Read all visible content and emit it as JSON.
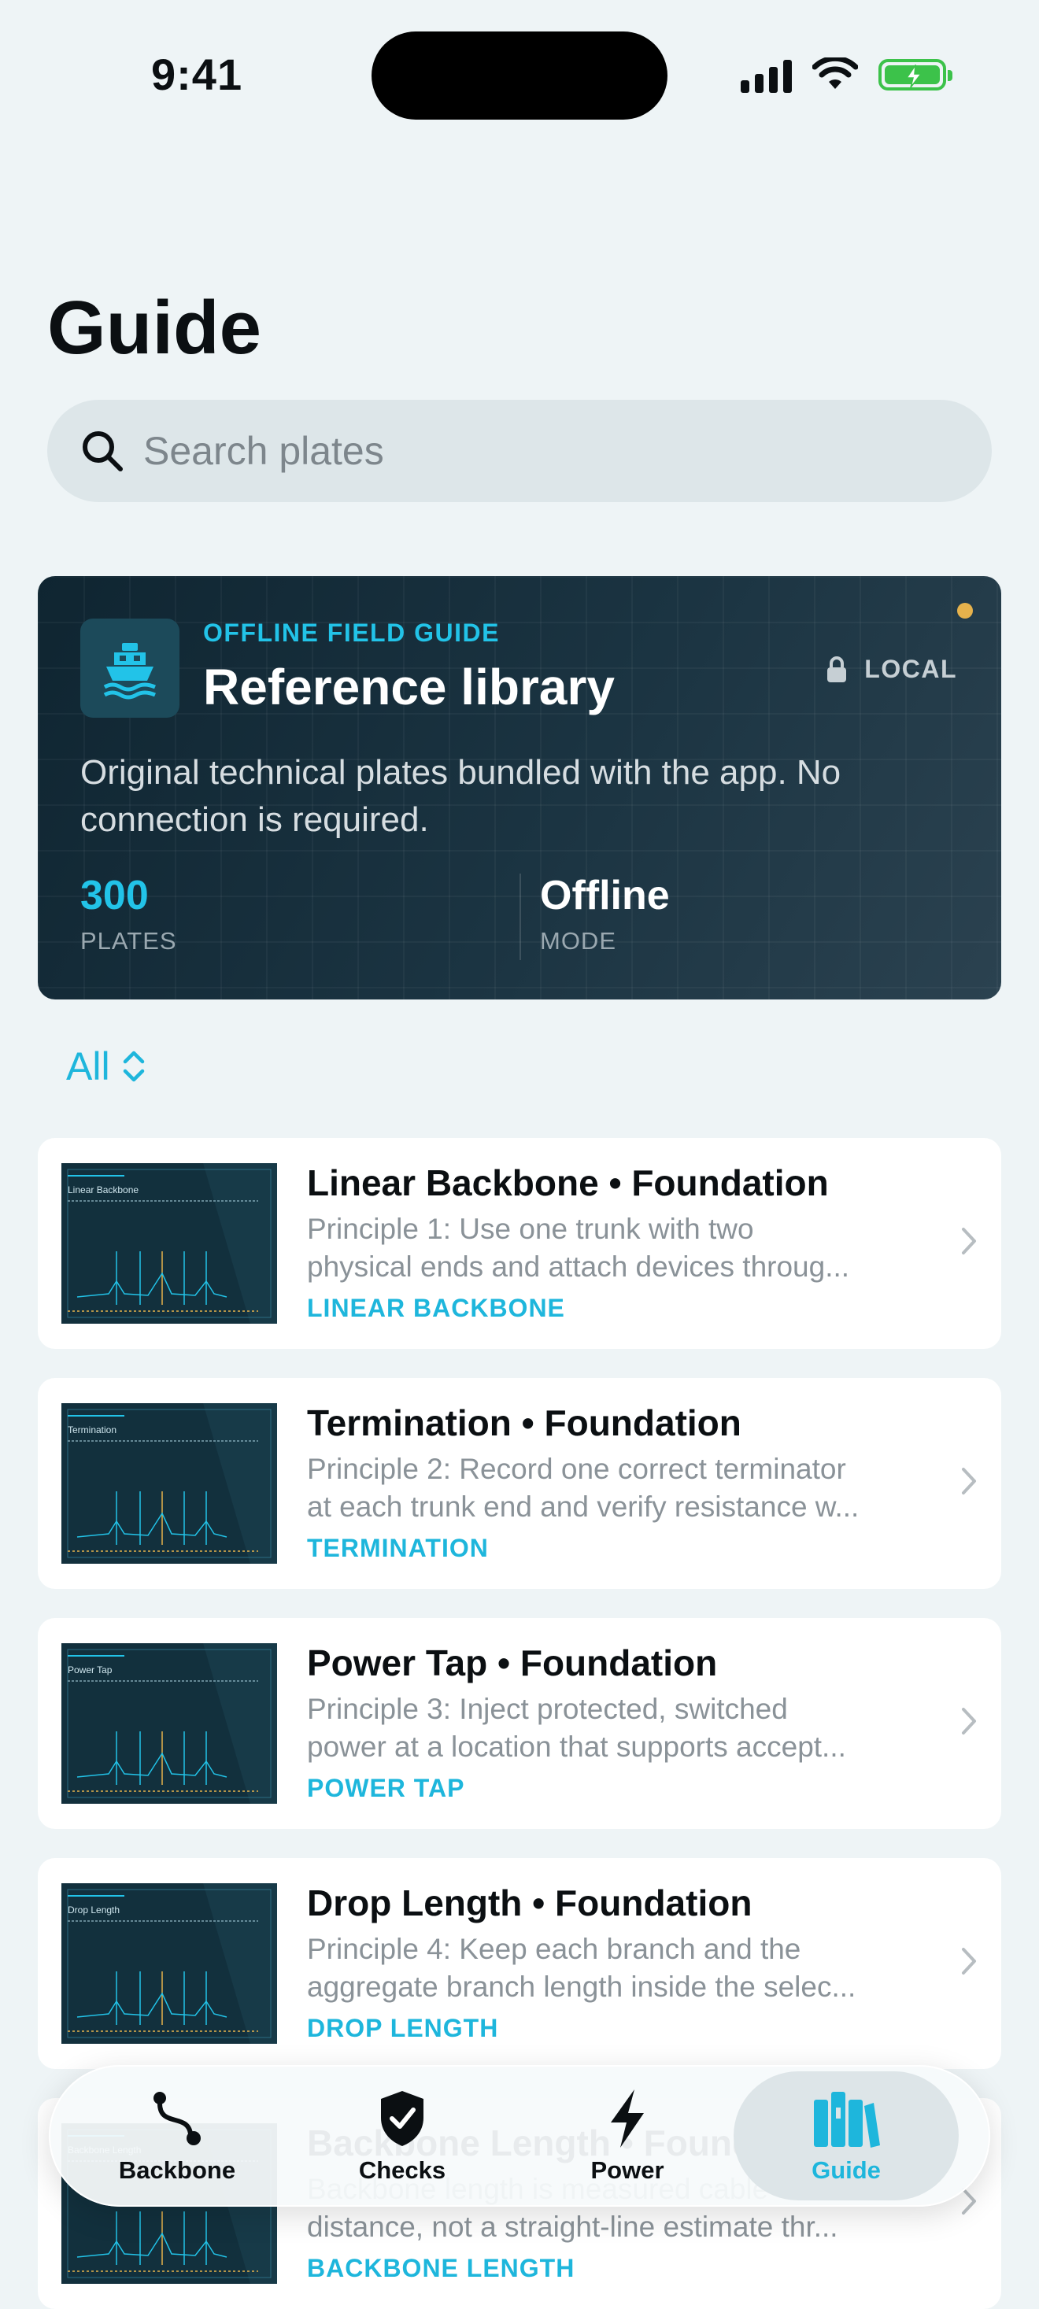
{
  "status_bar": {
    "time": "9:41"
  },
  "page": {
    "title": "Guide"
  },
  "search": {
    "placeholder": "Search plates"
  },
  "hero": {
    "eyebrow": "OFFLINE FIELD GUIDE",
    "title": "Reference library",
    "badge": "LOCAL",
    "description": "Original technical plates bundled with the app. No connection is required.",
    "stats": [
      {
        "value": "300",
        "label": "PLATES"
      },
      {
        "value": "Offline",
        "label": "MODE"
      }
    ]
  },
  "filter": {
    "label": "All"
  },
  "plates": [
    {
      "title": "Linear Backbone • Foundation",
      "desc_line1": "Principle 1: Use one trunk with two",
      "desc_line2": "physical ends and attach devices throug...",
      "tag": "LINEAR BACKBONE",
      "thumb_label": "Linear Backbone"
    },
    {
      "title": "Termination • Foundation",
      "desc_line1": "Principle 2: Record one correct terminator",
      "desc_line2": "at each trunk end and verify resistance w...",
      "tag": "TERMINATION",
      "thumb_label": "Termination"
    },
    {
      "title": "Power Tap • Foundation",
      "desc_line1": "Principle 3: Inject protected, switched",
      "desc_line2": "power at a location that supports accept...",
      "tag": "POWER TAP",
      "thumb_label": "Power Tap"
    },
    {
      "title": "Drop Length • Foundation",
      "desc_line1": "Principle 4: Keep each branch and the",
      "desc_line2": "aggregate branch length inside the selec...",
      "tag": "DROP LENGTH",
      "thumb_label": "Drop Length"
    },
    {
      "title": "Backbone Length • Foundation",
      "desc_line1": "Backbone length is measured cable",
      "desc_line2": "distance, not a straight-line estimate thr...",
      "tag": "BACKBONE LENGTH",
      "thumb_label": "Backbone Length"
    }
  ],
  "tabs": [
    {
      "label": "Backbone",
      "icon": "route-icon"
    },
    {
      "label": "Checks",
      "icon": "shield-check-icon"
    },
    {
      "label": "Power",
      "icon": "bolt-icon"
    },
    {
      "label": "Guide",
      "icon": "books-icon",
      "active": true
    }
  ],
  "colors": {
    "accent": "#1eb6dc",
    "hero_bg": "#1b3442",
    "status_dot": "#e6b24c",
    "battery": "#3cc24a"
  }
}
